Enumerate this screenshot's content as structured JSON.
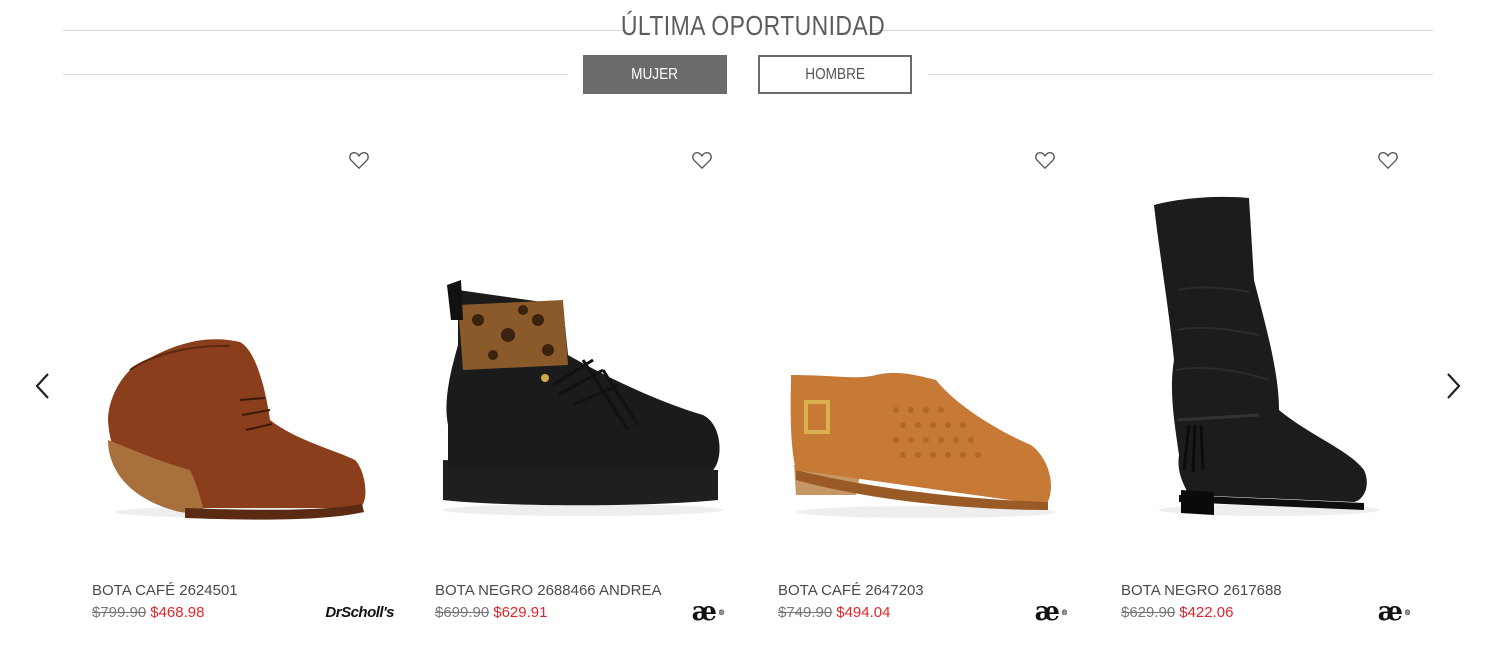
{
  "section": {
    "title": "ÚLTIMA OPORTUNIDAD",
    "tabs": [
      {
        "label": "MUJER",
        "active": true
      },
      {
        "label": "HOMBRE",
        "active": false
      }
    ]
  },
  "carousel": {
    "prev_icon": "chevron-left-icon",
    "next_icon": "chevron-right-icon"
  },
  "products": [
    {
      "name": "BOTA CAFÉ 2624501",
      "old_price": "$799.90",
      "price": "$468.98",
      "brand": "DrScholl's",
      "color": "#8a3e1c"
    },
    {
      "name": "BOTA NEGRO 2688466 ANDREA",
      "old_price": "$699.90",
      "price": "$629.91",
      "brand": "æ",
      "color": "#1a1a1a"
    },
    {
      "name": "BOTA CAFÉ 2647203",
      "old_price": "$749.90",
      "price": "$494.04",
      "brand": "æ",
      "color": "#c77a35"
    },
    {
      "name": "BOTA NEGRO 2617688",
      "old_price": "$629.90",
      "price": "$422.06",
      "brand": "æ",
      "color": "#1c1c1c"
    }
  ],
  "colors": {
    "accent_price": "#e0252b",
    "tab_active_bg": "#6b6b6b"
  }
}
